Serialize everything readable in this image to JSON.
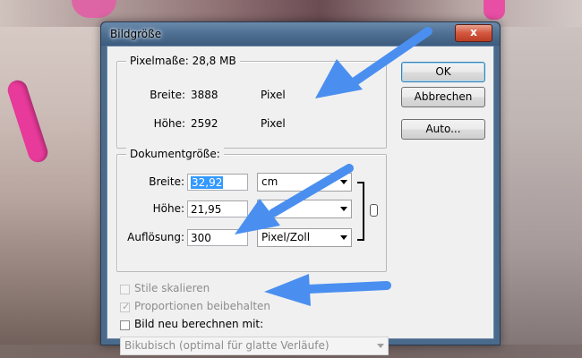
{
  "dialog": {
    "title": "Bildgröße",
    "close_label": "x"
  },
  "pixel": {
    "legend": "Pixelmaße: 28,8 MB",
    "breite_label": "Breite:",
    "breite_value": "3888",
    "breite_unit": "Pixel",
    "hoehe_label": "Höhe:",
    "hoehe_value": "2592",
    "hoehe_unit": "Pixel"
  },
  "document": {
    "legend": "Dokumentgröße:",
    "breite_label": "Breite:",
    "breite_value": "32,92",
    "breite_unit": "cm",
    "hoehe_label": "Höhe:",
    "hoehe_value": "21,95",
    "hoehe_unit": "",
    "aufloesung_label": "Auflösung:",
    "aufloesung_value": "300",
    "aufloesung_unit": "Pixel/Zoll"
  },
  "options": {
    "stile_label": "Stile skalieren",
    "proportionen_label": "Proportionen beibehalten",
    "bild_neu_label": "Bild neu berechnen mit:",
    "interpolation_value": "Bikubisch (optimal für glatte Verläufe)"
  },
  "buttons": {
    "ok": "OK",
    "abbrechen": "Abbrechen",
    "auto": "Auto..."
  },
  "colors": {
    "arrow": "#4a8ff0",
    "selection": "#3399ff"
  }
}
